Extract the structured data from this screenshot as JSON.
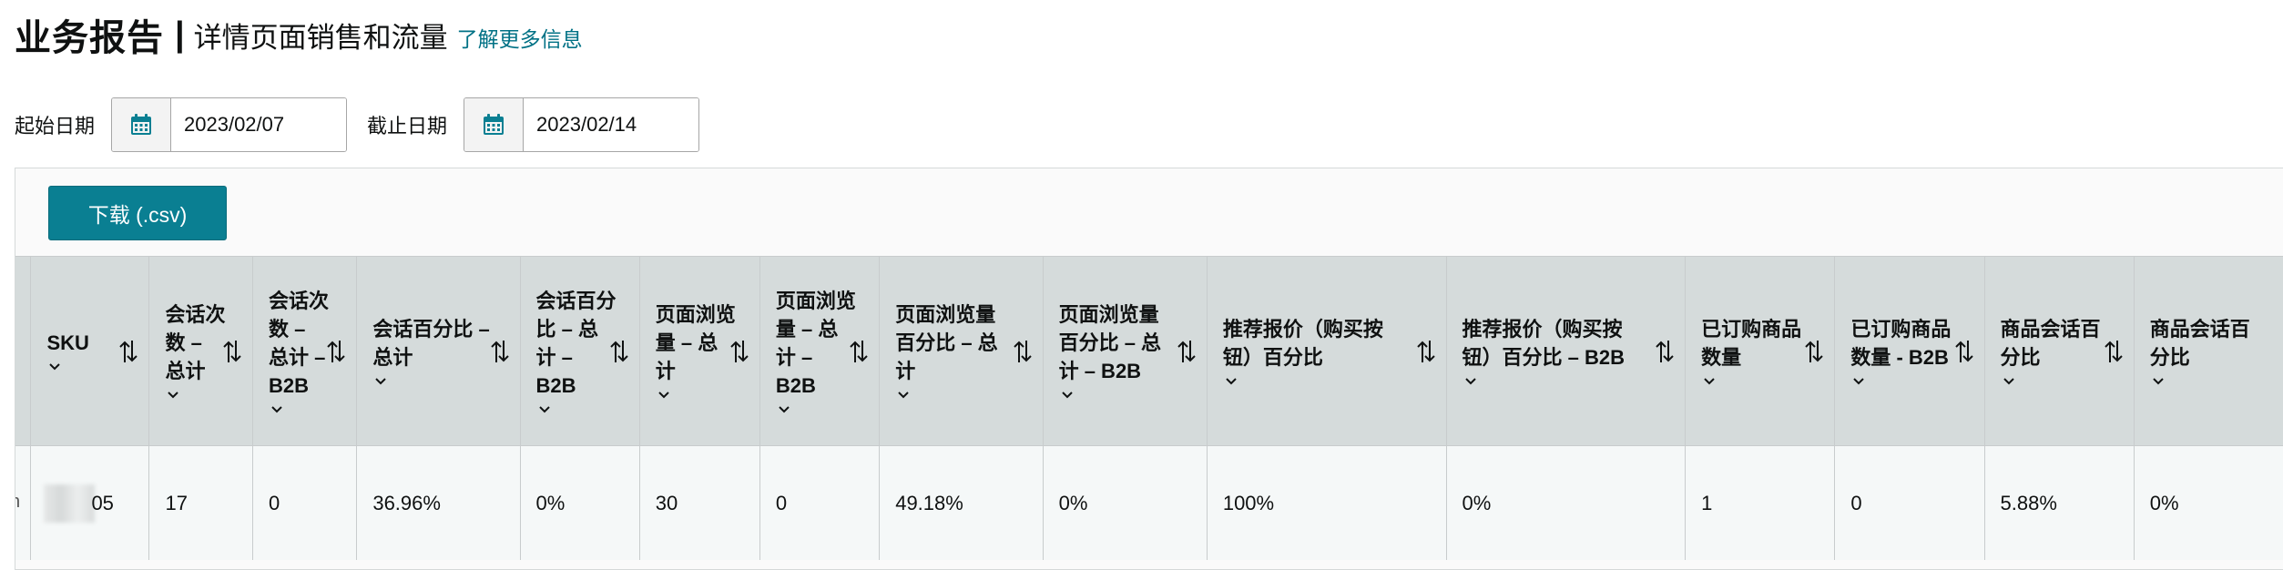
{
  "header": {
    "title": "业务报告",
    "separator": "|",
    "subtitle": "详情页面销售和流量",
    "learn_more": "了解更多信息"
  },
  "filters": {
    "start_label": "起始日期",
    "start_value": "2023/02/07",
    "end_label": "截止日期",
    "end_value": "2023/02/14"
  },
  "toolbar": {
    "download_label": "下载 (.csv)"
  },
  "table": {
    "columns": [
      {
        "label": "SKU"
      },
      {
        "label": "会话次数 – 总计"
      },
      {
        "label": "会话次数 – 总计 – B2B"
      },
      {
        "label": "会话百分比 – 总计"
      },
      {
        "label": "会话百分比 – 总计 – B2B"
      },
      {
        "label": "页面浏览量 – 总计"
      },
      {
        "label": "页面浏览量 – 总计 – B2B"
      },
      {
        "label": "页面浏览量百分比 – 总计"
      },
      {
        "label": "页面浏览量百分比 – 总计 – B2B"
      },
      {
        "label": "推荐报价（购买按钮）百分比"
      },
      {
        "label": "推荐报价（购买按钮）百分比 – B2B"
      },
      {
        "label": "已订购商品数量"
      },
      {
        "label": "已订购商品数量 - B2B"
      },
      {
        "label": "商品会话百分比"
      },
      {
        "label": "商品会话百分比"
      }
    ],
    "rows": [
      {
        "sku_suffix": "05",
        "cells": [
          "17",
          "0",
          "36.96%",
          "0%",
          "30",
          "0",
          "49.18%",
          "0%",
          "100%",
          "0%",
          "1",
          "0",
          "5.88%",
          "0%"
        ]
      }
    ]
  }
}
